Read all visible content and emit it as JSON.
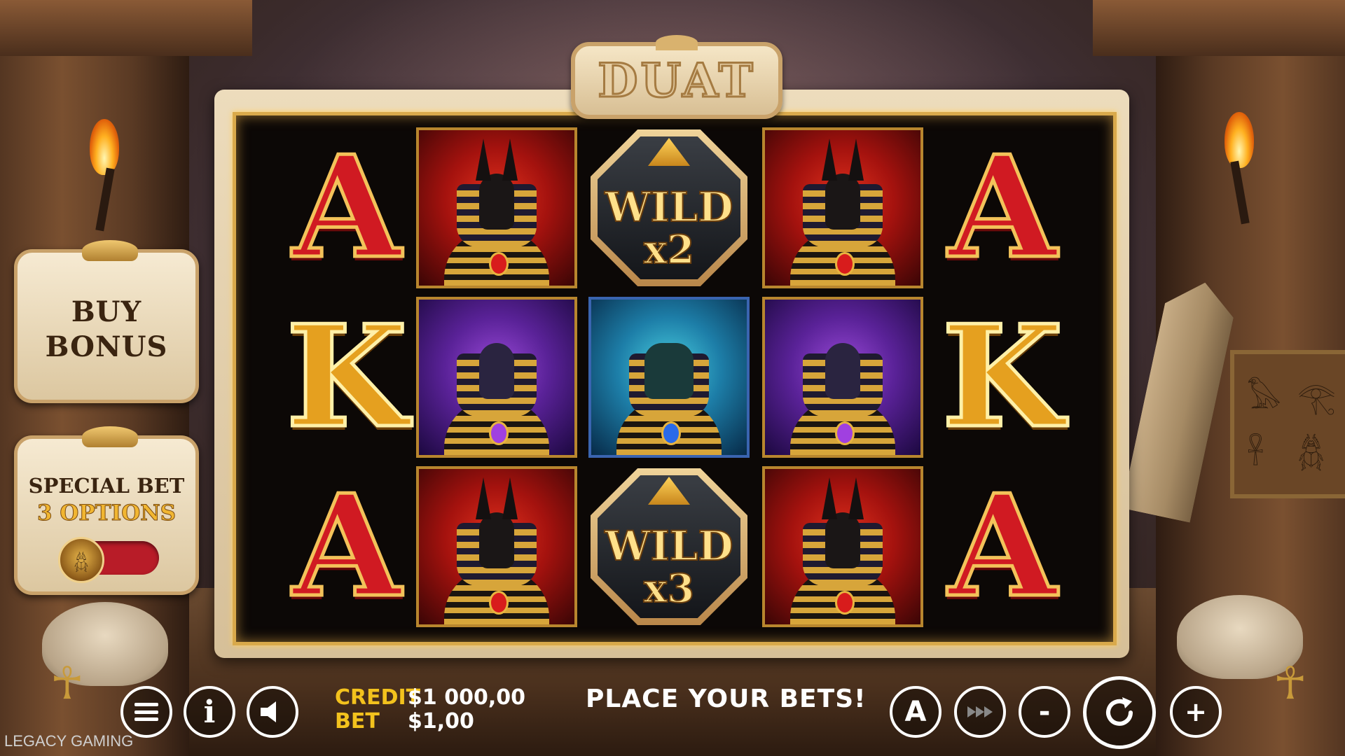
{
  "game": {
    "title": "DUAT",
    "brand": "LEGACY GAMING",
    "message": "PLACE YOUR BETS!"
  },
  "side_panels": {
    "buy_bonus": {
      "line1": "BUY",
      "line2": "BONUS"
    },
    "special_bet": {
      "line1": "SPECIAL BET",
      "line2": "3 OPTIONS",
      "toggle_on": false
    }
  },
  "reels": {
    "columns": 5,
    "rows": 3,
    "grid": [
      [
        "A",
        "anubis",
        "wild",
        "anubis",
        "A"
      ],
      [
        "K",
        "horus",
        "sobek",
        "horus",
        "K"
      ],
      [
        "A",
        "anubis",
        "wild",
        "anubis",
        "A"
      ]
    ],
    "wilds": [
      {
        "label": "WILD",
        "multiplier": "x2"
      },
      {
        "label": "WILD",
        "multiplier": "x3"
      }
    ]
  },
  "balance": {
    "credit_label": "CREDIT",
    "credit_value": "$1 000,00",
    "bet_label": "BET",
    "bet_value": "$1,00"
  },
  "controls": {
    "menu_icon": "menu-icon",
    "info_label": "i",
    "sound_icon": "speaker-icon",
    "autoplay_label": "A",
    "turbo_icon": "fast-forward-icon",
    "minus_label": "-",
    "spin_icon": "spin-icon",
    "plus_label": "+"
  },
  "colors": {
    "accent_gold": "#f3c21d",
    "frame_gold": "#d9a94b",
    "letter_red": "#d01a22",
    "toggle_red": "#b81c28"
  }
}
